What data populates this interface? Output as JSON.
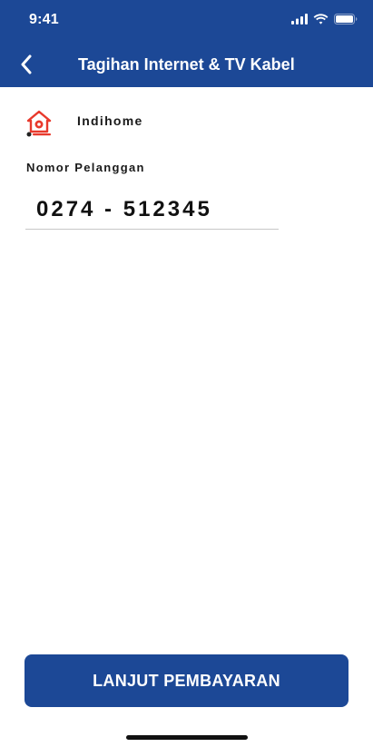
{
  "status_bar": {
    "time": "9:41"
  },
  "header": {
    "title": "Tagihan Internet & TV Kabel",
    "back_icon": "chevron-left-icon"
  },
  "provider": {
    "name": "Indihome",
    "logo_icon": "indihome-logo",
    "brand_color": "#e8392c"
  },
  "form": {
    "customer_number_label": "Nomor Pelanggan",
    "customer_number_value": "0274 - 512345"
  },
  "footer": {
    "submit_label": "LANJUT PEMBAYARAN"
  },
  "colors": {
    "primary": "#1c4896",
    "text": "#1a1a1a",
    "divider": "#c8c8c8"
  }
}
